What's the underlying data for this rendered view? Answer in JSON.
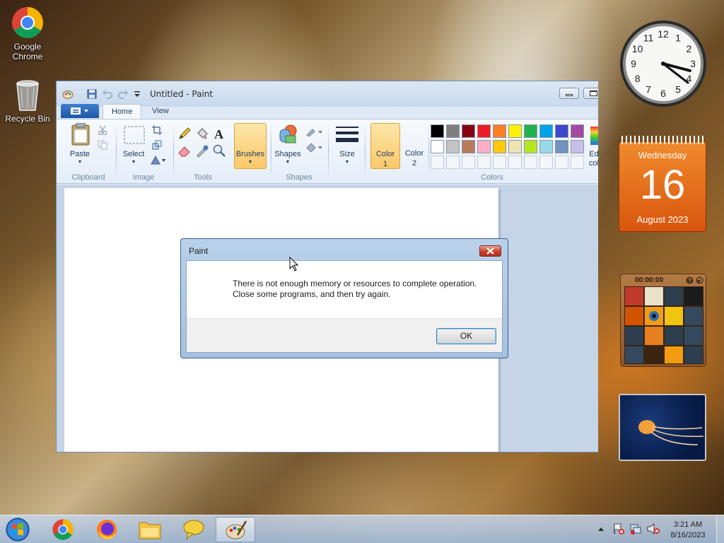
{
  "desktop": {
    "icons": [
      {
        "label_line1": "Google",
        "label_line2": "Chrome",
        "icon": "chrome-icon"
      },
      {
        "label_line1": "Recycle Bin",
        "label_line2": "",
        "icon": "recycle-bin-icon"
      }
    ]
  },
  "paint": {
    "window_title": "Untitled - Paint",
    "tabs": [
      {
        "label": "Home",
        "active": true
      },
      {
        "label": "View",
        "active": false
      }
    ],
    "groups": {
      "clipboard": "Clipboard",
      "image": "Image",
      "tools": "Tools",
      "shapes": "Shapes",
      "colors": "Colors"
    },
    "buttons": {
      "paste": "Paste",
      "select": "Select",
      "brushes": "Brushes",
      "shapes": "Shapes",
      "size": "Size",
      "color1": "Color 1",
      "color1_line1": "Color",
      "color1_line2": "1",
      "color2_line1": "Color",
      "color2_line2": "2",
      "edit_colors_line1": "Ed",
      "edit_colors_line2": "col"
    },
    "palette_row1": [
      "#000000",
      "#7f7f7f",
      "#880015",
      "#ed1c24",
      "#ff7f27",
      "#fff200",
      "#22b14c",
      "#00a2e8",
      "#3f48cc",
      "#a349a4"
    ],
    "palette_row2": [
      "#ffffff",
      "#c3c3c3",
      "#b97a57",
      "#ffaec9",
      "#ffc90e",
      "#efe4b0",
      "#b5e61d",
      "#99d9ea",
      "#7092be",
      "#c8bfe7"
    ]
  },
  "dialog": {
    "title": "Paint",
    "message_line1": "There is not enough memory or resources to complete operation.",
    "message_line2": "Close some programs, and then try again.",
    "ok_label": "OK"
  },
  "gadgets": {
    "clock_numbers": [
      "12",
      "1",
      "2",
      "3",
      "4",
      "5",
      "6",
      "7",
      "8",
      "9",
      "10",
      "11"
    ],
    "calendar": {
      "weekday": "Wednesday",
      "day": "16",
      "month_year": "August 2023"
    },
    "puzzle": {
      "timer": "00:00:00"
    }
  },
  "taskbar": {
    "time": "3:21 AM",
    "date": "8/16/2023",
    "pinned": [
      "start-orb",
      "chrome",
      "firefox",
      "file-explorer",
      "messenger",
      "paint"
    ]
  }
}
